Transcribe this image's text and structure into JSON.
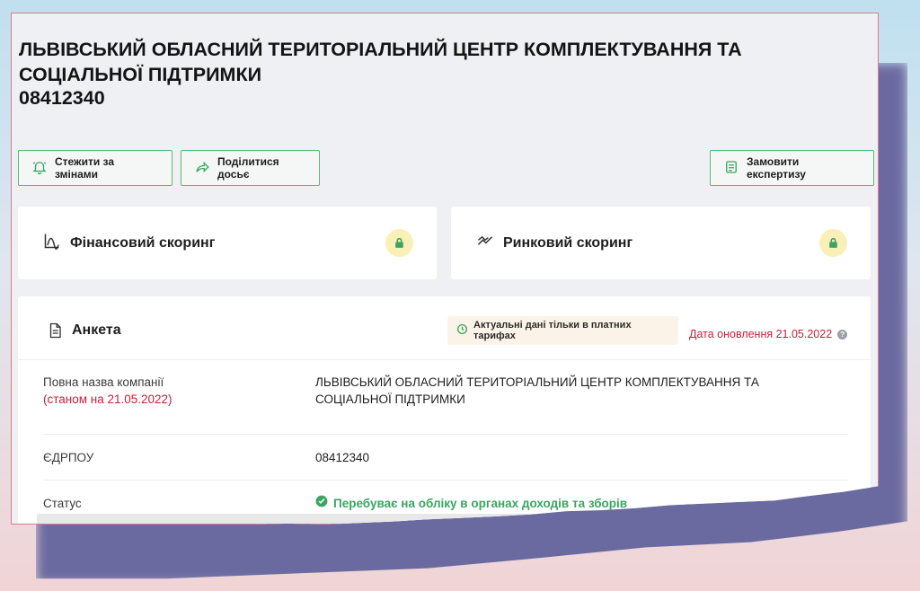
{
  "company": {
    "title": "ЛЬВІВСЬКИЙ ОБЛАСНИЙ ТЕРИТОРІАЛЬНИЙ ЦЕНТР КОМПЛЕКТУВАННЯ ТА СОЦІАЛЬНОЇ ПІДТРИМКИ",
    "code": "08412340"
  },
  "actions": {
    "follow": "Стежити за змінами",
    "share": "Поділитися досьє",
    "order": "Замовити експертизу"
  },
  "scoring": {
    "financial": "Фінансовий скоринг",
    "market": "Ринковий скоринг"
  },
  "form": {
    "title": "Анкета",
    "badge": "Актуальні дані тільки в платних тарифах",
    "updated": "Дата оновлення 21.05.2022",
    "rows": {
      "name_label": "Повна назва компанії",
      "name_note": "(станом на 21.05.2022)",
      "name_value": "ЛЬВІВСЬКИЙ ОБЛАСНИЙ ТЕРИТОРІАЛЬНИЙ ЦЕНТР КОМПЛЕКТУВАННЯ ТА СОЦІАЛЬНОЇ ПІДТРИМКИ",
      "edrpou_label": "ЄДРПОУ",
      "edrpou_value": "08412340",
      "status_label": "Статус",
      "status_value": "Перебуває на обліку в органах доходів та зборів"
    }
  },
  "colors": {
    "accent": "#5cb87a",
    "warning": "#c6203a",
    "status": "#3aa561"
  }
}
